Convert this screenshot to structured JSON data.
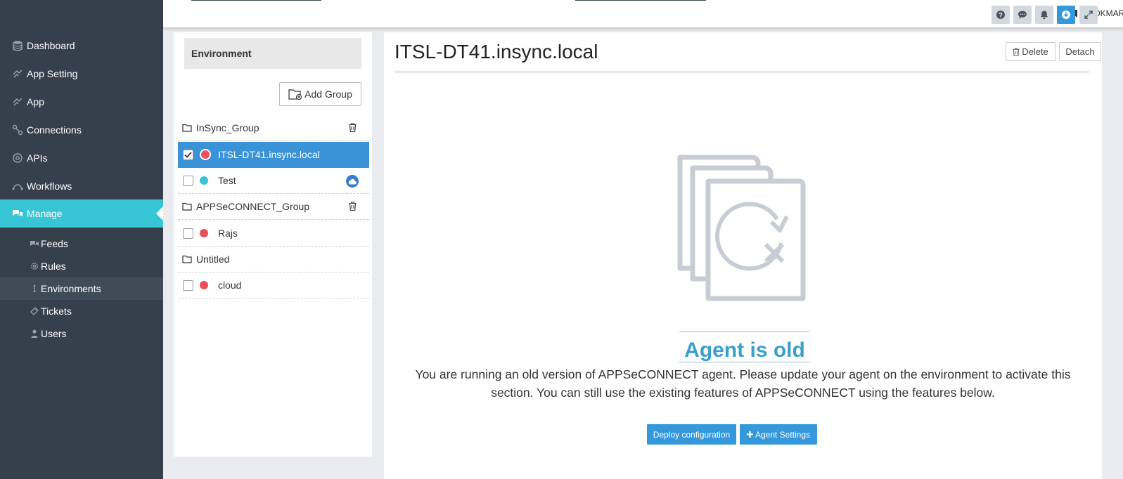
{
  "sidebar": {
    "items": [
      {
        "label": "Dashboard",
        "icon": "database-icon"
      },
      {
        "label": "App Setting",
        "icon": "app-setting-icon"
      },
      {
        "label": "App",
        "icon": "app-icon"
      },
      {
        "label": "Connections",
        "icon": "connections-icon"
      },
      {
        "label": "APIs",
        "icon": "apis-icon"
      },
      {
        "label": "Workflows",
        "icon": "workflows-icon"
      },
      {
        "label": "Manage",
        "icon": "comments-icon",
        "active": true
      }
    ],
    "subitems": [
      {
        "label": "Feeds",
        "icon": "feeds-icon"
      },
      {
        "label": "Rules",
        "icon": "gear-icon"
      },
      {
        "label": "Environments",
        "icon": "info-icon",
        "current": true
      },
      {
        "label": "Tickets",
        "icon": "ticket-icon"
      },
      {
        "label": "Users",
        "icon": "user-icon"
      }
    ]
  },
  "topbar": {
    "bookmarks_label": "BOOKMARKS",
    "buttons": [
      "help-icon",
      "chat-icon",
      "bell-icon",
      "download-icon",
      "expand-icon"
    ]
  },
  "env_panel": {
    "header": "Environment",
    "add_group_label": "Add Group",
    "tree": [
      {
        "type": "group",
        "label": "InSync_Group",
        "deletable": true
      },
      {
        "type": "env",
        "label": "ITSL-DT41.insync.local",
        "status": "red",
        "checked": true,
        "selected": true
      },
      {
        "type": "env",
        "label": "Test",
        "status": "teal",
        "checked": false,
        "cloud": true
      },
      {
        "type": "group",
        "label": "APPSeCONNECT_Group",
        "deletable": true
      },
      {
        "type": "env",
        "label": "Rajs",
        "status": "red",
        "checked": false
      },
      {
        "type": "group",
        "label": "Untitled",
        "deletable": false
      },
      {
        "type": "env",
        "label": "cloud",
        "status": "red",
        "checked": false
      }
    ]
  },
  "main": {
    "title": "ITSL-DT41.insync.local",
    "delete_label": "Delete",
    "detach_label": "Detach",
    "status_title": "Agent is old",
    "status_desc": "You are running an old version of APPSeCONNECT agent. Please update your agent on the environment to activate this section. You can still use the existing features of APPSeCONNECT using the features below.",
    "deploy_label": "Deploy configuration",
    "agent_settings_label": "Agent Settings"
  },
  "colors": {
    "sidebar_bg": "#36404c",
    "active_accent": "#37c4d4",
    "primary": "#3498db",
    "status_red": "#e8505b",
    "status_teal": "#37c4d4",
    "heading_blue": "#3a9fc9"
  }
}
